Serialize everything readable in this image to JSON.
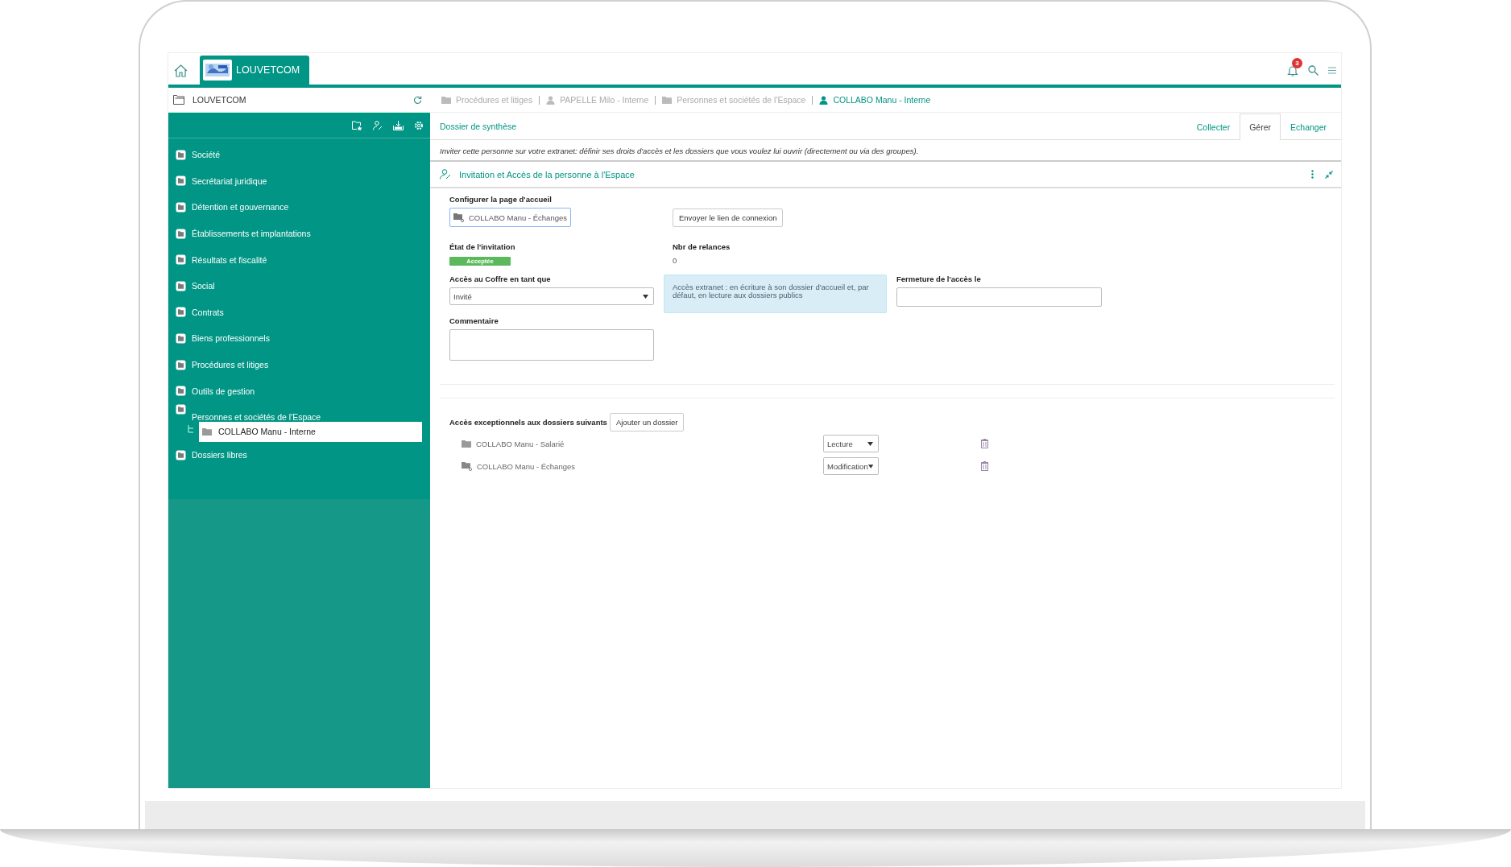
{
  "header": {
    "space_tab": {
      "label": "LOUVETCOM",
      "selected": true
    },
    "notifications": {
      "count": "3"
    }
  },
  "sidebar": {
    "title": "LOUVETCOM",
    "items": [
      {
        "label": "Société",
        "selected": false
      },
      {
        "label": "Secrétariat juridique",
        "selected": false
      },
      {
        "label": "Détention et gouvernance",
        "selected": false
      },
      {
        "label": "Établissements et implantations",
        "selected": false
      },
      {
        "label": "Résultats et fiscalité",
        "selected": false
      },
      {
        "label": "Social",
        "selected": false
      },
      {
        "label": "Contrats",
        "selected": false
      },
      {
        "label": "Biens professionnels",
        "selected": false
      },
      {
        "label": "Procédures et litiges",
        "selected": false
      },
      {
        "label": "Outils de gestion",
        "selected": false
      },
      {
        "label": "Personnes et sociétés de l'Espace",
        "selected": false,
        "children": [
          {
            "label": "COLLABO Manu - Interne",
            "selected": true
          }
        ]
      },
      {
        "label": "Dossiers libres",
        "selected": false
      }
    ]
  },
  "breadcrumb": [
    {
      "label": "Procédures et litiges",
      "kind": "folder",
      "current": false
    },
    {
      "label": "PAPELLE Milo - Interne",
      "kind": "person",
      "current": false
    },
    {
      "label": "Personnes et sociétés de l'Espace",
      "kind": "folder",
      "current": false
    },
    {
      "label": "COLLABO Manu - Interne",
      "kind": "person",
      "current": true
    }
  ],
  "subnav": {
    "title": "Dossier de synthèse",
    "tabs": [
      {
        "label": "Collecter",
        "selected": false
      },
      {
        "label": "Gérer",
        "selected": true
      },
      {
        "label": "Echanger",
        "selected": false
      }
    ]
  },
  "info": "Inviter cette personne sur votre extranet: définir ses droits d'accès et les dossiers que vous voulez lui ouvrir (directement ou via des groupes).",
  "panel": {
    "title": "Invitation et Accès de la personne à l'Espace",
    "home_page": {
      "label": "Configurer la page d'accueil",
      "value": "COLLABO Manu - Échanges"
    },
    "send_link_button": "Envoyer le lien de connexion",
    "invitation_state": {
      "label": "État de l'invitation",
      "badge": "Acceptée"
    },
    "reminders": {
      "label": "Nbr de relances",
      "value": "0"
    },
    "role": {
      "label": "Accès au Coffre en tant que",
      "value": "Invité"
    },
    "role_note": "Accès extranet : en écriture à son dossier d'accueil et, par défaut, en lecture aux dossiers publics",
    "closing_date": {
      "label": "Fermeture de l'accès le"
    },
    "comment": {
      "label": "Commentaire"
    },
    "exceptions": {
      "label": "Accès exceptionnels aux dossiers suivants",
      "add_button": "Ajouter un dossier",
      "rows": [
        {
          "folder": "COLLABO Manu - Salarié",
          "kind": "folder",
          "access": "Lecture"
        },
        {
          "folder": "COLLABO Manu - Échanges",
          "kind": "shared",
          "access": "Modification"
        }
      ]
    }
  }
}
